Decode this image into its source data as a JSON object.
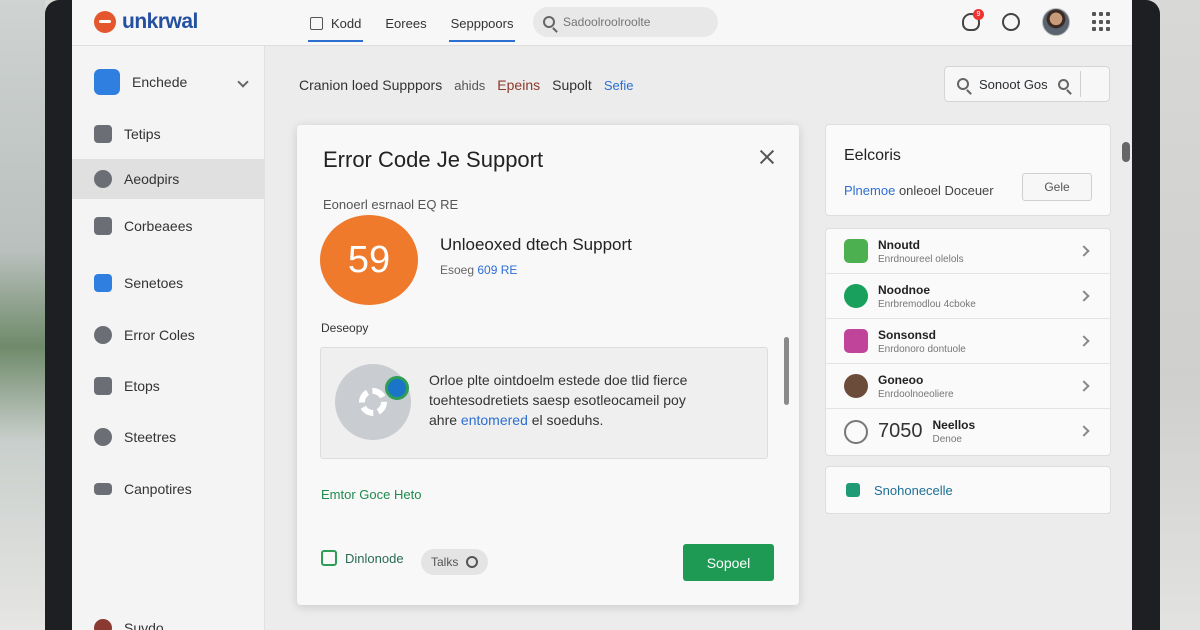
{
  "header": {
    "logo_text": "unkrwal",
    "tabs": [
      {
        "label": "Kodd"
      },
      {
        "label": "Eorees"
      },
      {
        "label": "Sepppoors"
      }
    ],
    "search_placeholder": "Sadoolroolroolte",
    "notification_count": "9"
  },
  "sidebar": {
    "items": [
      {
        "label": "Enchede",
        "icon": "shield-icon"
      },
      {
        "label": "Tetips",
        "icon": "image-icon"
      },
      {
        "label": "Aeodpirs",
        "icon": "gear-icon"
      },
      {
        "label": "Corbeaees",
        "icon": "folder-icon"
      },
      {
        "label": "Senetoes",
        "icon": "bag-icon"
      },
      {
        "label": "Error Coles",
        "icon": "globe-icon"
      },
      {
        "label": "Etops",
        "icon": "printer-icon"
      },
      {
        "label": "Steetres",
        "icon": "settings-icon"
      },
      {
        "label": "Canpotires",
        "icon": "card-icon"
      },
      {
        "label": "Suvdo",
        "icon": "user-icon"
      }
    ]
  },
  "breadcrumb": {
    "items": [
      "Cranion loed Supppors",
      "ahids",
      "Epeins",
      "Supolt",
      "Sefie"
    ]
  },
  "top_search": {
    "label": "Sonoot Gos"
  },
  "dialog": {
    "title": "Error Code Je Support",
    "code_label": "Eonoerl esrnaol EQ RE",
    "code": "59",
    "error_title": "Unloeoxed dtech Support",
    "error_sub_prefix": "Esoeg",
    "error_sub_link": "609 RE",
    "desc_label": "Deseopy",
    "desc_line1": "Orloe plte ointdoelm estede doe tlid fierce",
    "desc_line2": "toehtesodretiets saesp esotleocameil poy",
    "desc_line3_prefix": "ahre",
    "desc_line3_link": "entomered",
    "desc_line3_suffix": "el soeduhs.",
    "help_link": "Emtor Goce Heto",
    "footer_link": "Dinlonode",
    "pill_label": "Talks",
    "primary_button": "Sopoel"
  },
  "right_panel": {
    "title": "Eelcoris",
    "line_prefix": "Plnemoe",
    "line_suffix": "onleoel Doceuer",
    "button": "Gele",
    "items": [
      {
        "name": "Nnoutd",
        "sub": "Enrdnoureel olelols",
        "icon_color": "#4caf50"
      },
      {
        "name": "Noodnoe",
        "sub": "Enrbremodlou 4cboke",
        "icon_color": "#18a05c"
      },
      {
        "name": "Sonsonsd",
        "sub": "Enrdonoro dontuole",
        "icon_color": "#c0449a"
      },
      {
        "name": "Goneoo",
        "sub": "Enrdoolnoeoliere",
        "icon_color": "#6b4b3a"
      },
      {
        "name": "Neellos",
        "sub": "Denoe",
        "number": "7050",
        "icon_color": "#777777"
      }
    ],
    "bottom_label": "Snohonecelle"
  }
}
